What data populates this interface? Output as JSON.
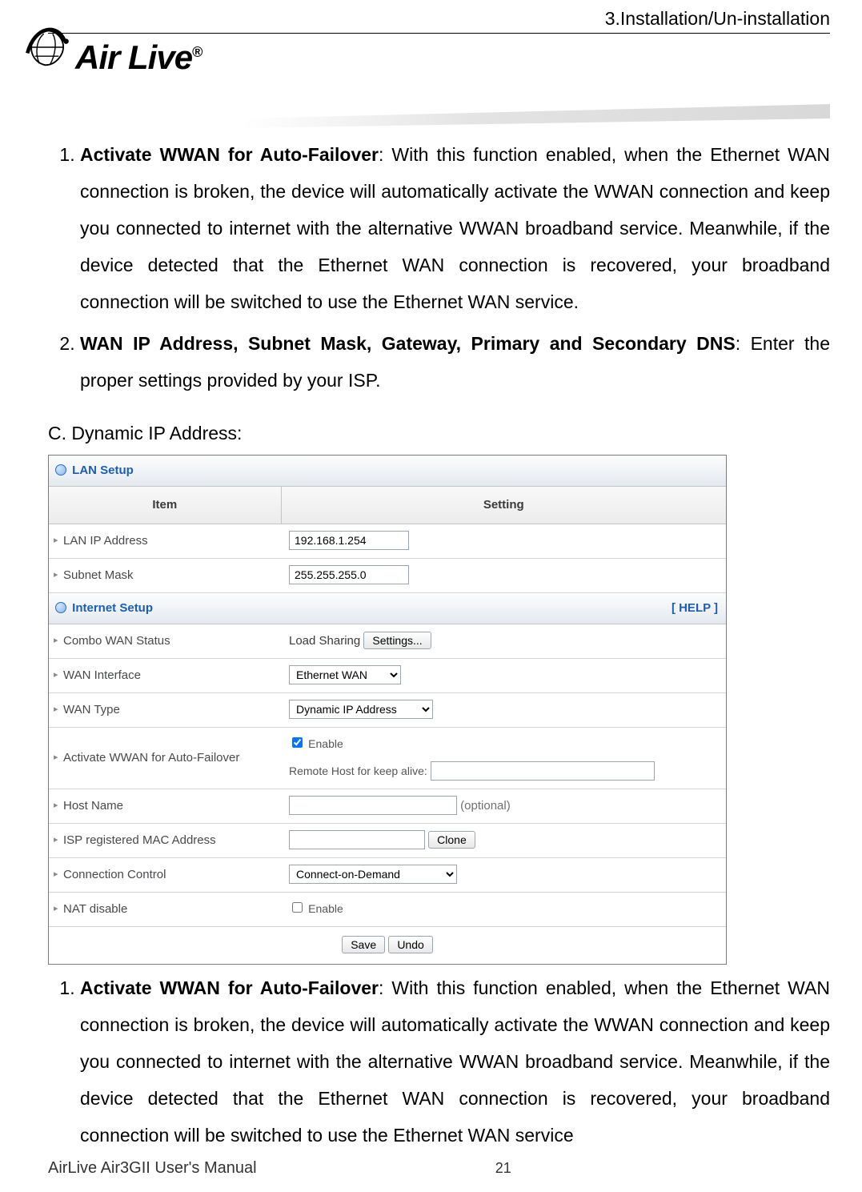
{
  "header": {
    "section": "3.Installation/Un-installation",
    "brand": "Air Live",
    "brand_r": "®"
  },
  "list_top": [
    {
      "bold": "Activate WWAN for Auto-Failover",
      "rest": ": With this function enabled, when the Ethernet WAN connection is broken, the device will automatically activate the WWAN connection and keep you connected to internet with the alternative WWAN broadband service. Meanwhile, if the device detected that the Ethernet WAN connection is recovered, your broadband connection will be switched to use the Ethernet WAN service."
    },
    {
      "bold": "WAN IP Address, Subnet Mask, Gateway, Primary and Secondary DNS",
      "rest": ": Enter the proper settings provided by your ISP."
    }
  ],
  "section_c": "C. Dynamic IP Address:",
  "panel": {
    "lan_title": "LAN Setup",
    "internet_title": "Internet Setup",
    "help": "[ HELP ]",
    "col_item": "Item",
    "col_setting": "Setting",
    "rows": {
      "lan_ip": {
        "label": "LAN IP Address",
        "value": "192.168.1.254"
      },
      "subnet": {
        "label": "Subnet Mask",
        "value": "255.255.255.0"
      },
      "combo": {
        "label": "Combo WAN Status",
        "prefix": "Load Sharing",
        "btn": "Settings..."
      },
      "wif": {
        "label": "WAN Interface",
        "value": "Ethernet WAN"
      },
      "wtype": {
        "label": "WAN Type",
        "value": "Dynamic IP Address"
      },
      "fail": {
        "label": "Activate WWAN for Auto-Failover",
        "checklabel": "Enable",
        "remote": "Remote Host for keep alive:",
        "remote_value": ""
      },
      "host": {
        "label": "Host Name",
        "value": "",
        "hint": "(optional)"
      },
      "mac": {
        "label": "ISP registered MAC Address",
        "value": "",
        "btn": "Clone"
      },
      "conn": {
        "label": "Connection Control",
        "value": "Connect-on-Demand"
      },
      "nat": {
        "label": "NAT disable",
        "checklabel": "Enable"
      }
    },
    "actions": {
      "save": "Save",
      "undo": "Undo"
    }
  },
  "list_bottom": [
    {
      "bold": "Activate WWAN for Auto-Failover",
      "rest": ": With this function enabled, when the Ethernet WAN connection is broken, the device will automatically activate the WWAN connection and keep you connected to internet with the alternative WWAN broadband service. Meanwhile, if the device detected that the Ethernet WAN connection is recovered, your broadband connection will be switched to use the Ethernet WAN service"
    }
  ],
  "footer": {
    "manual": "AirLive Air3GII User's Manual",
    "page": "21"
  }
}
